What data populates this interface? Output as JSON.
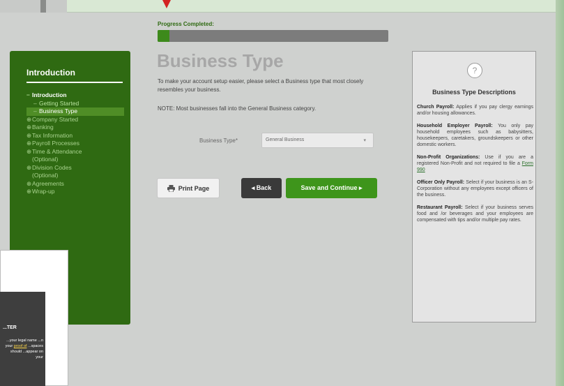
{
  "progress": {
    "label": "Progress Completed:",
    "percent": 5
  },
  "sidebar": {
    "title": "Introduction",
    "items": [
      {
        "label": "Introduction",
        "level": 0,
        "state": "current"
      },
      {
        "label": "Getting Started",
        "level": 1,
        "state": "normal"
      },
      {
        "label": "Business Type",
        "level": 1,
        "state": "active"
      },
      {
        "label": "Company Started",
        "level": 0,
        "state": "normal"
      },
      {
        "label": "Banking",
        "level": 0,
        "state": "normal"
      },
      {
        "label": "Tax Information",
        "level": 0,
        "state": "normal"
      },
      {
        "label": "Payroll Processes",
        "level": 0,
        "state": "normal"
      },
      {
        "label": "Time & Attendance",
        "level": 0,
        "state": "normal"
      },
      {
        "label": "(Optional)",
        "level": 0,
        "state": "continuation"
      },
      {
        "label": "Division Codes",
        "level": 0,
        "state": "normal"
      },
      {
        "label": "(Optional)",
        "level": 0,
        "state": "continuation"
      },
      {
        "label": "Agreements",
        "level": 0,
        "state": "normal"
      },
      {
        "label": "Wrap-up",
        "level": 0,
        "state": "normal"
      }
    ]
  },
  "main": {
    "title": "Business Type",
    "intro": "To make your account setup easier, please select a Business type that most closely resembles your business.",
    "note": "NOTE: Most businesses fall into the General Business category.",
    "field_label": "Business Type*",
    "select_value": "General Business"
  },
  "buttons": {
    "print": "Print Page",
    "back": "◂ Back",
    "save": "Save and Continue ▸"
  },
  "descriptions": {
    "title": "Business Type Descriptions",
    "entries": [
      {
        "term": "Church Payroll:",
        "text": "Applies if you pay clergy earnings and/or housing allowances."
      },
      {
        "term": "Household Employer Payroll:",
        "text": "You only pay household employees such as babysitters, housekeepers, caretakers, groundskeepers or other domestic workers."
      },
      {
        "term": "Non-Profit Organizations:",
        "text": "Use if you are a registered Non-Profit and not required to file a",
        "link": "Form 990"
      },
      {
        "term": "Officer Only Payroll:",
        "text": "Select if your business is an S-Corporation without any employees except officers of the business."
      },
      {
        "term": "Restaurant Payroll:",
        "text": "Select if your business serves food and /or beverages and your employees are compensated with tips and/or multiple pay rates."
      }
    ]
  },
  "overlay": {
    "title": "...TER",
    "text_a": "...your legal name ...n your",
    "link": "proof of",
    "text_b": "...spaces should ...appear on your"
  },
  "colors": {
    "sidebar_green": "#2f6a12",
    "accent_green": "#3e951b",
    "progress_track": "#7c7c7c"
  }
}
